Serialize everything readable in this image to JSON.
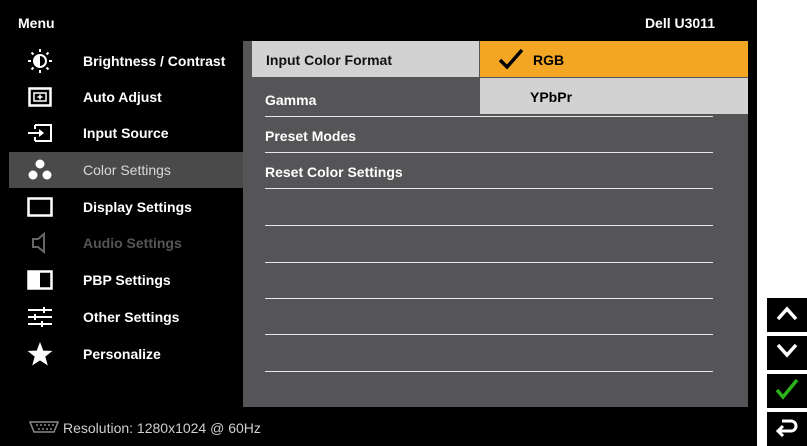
{
  "header": {
    "menu_title": "Menu",
    "model": "Dell U3011"
  },
  "sidebar": {
    "items": [
      {
        "label": "Brightness / Contrast",
        "icon": "brightness-icon",
        "state": "normal"
      },
      {
        "label": "Auto Adjust",
        "icon": "auto-adjust-icon",
        "state": "normal"
      },
      {
        "label": "Input Source",
        "icon": "input-source-icon",
        "state": "normal"
      },
      {
        "label": "Color Settings",
        "icon": "color-settings-icon",
        "state": "active"
      },
      {
        "label": "Display Settings",
        "icon": "display-settings-icon",
        "state": "normal"
      },
      {
        "label": "Audio Settings",
        "icon": "speaker-icon",
        "state": "disabled"
      },
      {
        "label": "PBP Settings",
        "icon": "pbp-icon",
        "state": "normal"
      },
      {
        "label": "Other Settings",
        "icon": "sliders-icon",
        "state": "normal"
      },
      {
        "label": "Personalize",
        "icon": "star-icon",
        "state": "normal"
      }
    ]
  },
  "main": {
    "rows": [
      {
        "label": "Input Color Format"
      },
      {
        "label": "Gamma"
      },
      {
        "label": "Preset Modes"
      },
      {
        "label": "Reset Color Settings"
      }
    ],
    "options": {
      "selected": "RGB",
      "other": "YPbPr"
    }
  },
  "footer": {
    "resolution": "Resolution: 1280x1024 @ 60Hz",
    "icon": "vga-connector-icon"
  },
  "nav_buttons": [
    "up-arrow-icon",
    "down-arrow-icon",
    "checkmark-icon",
    "back-icon"
  ],
  "colors": {
    "highlight": "#f2a623",
    "selected_row": "#d2d2d2",
    "panel": "#555558",
    "active_item": "#4a4a4a",
    "check_green": "#2bb21b"
  }
}
